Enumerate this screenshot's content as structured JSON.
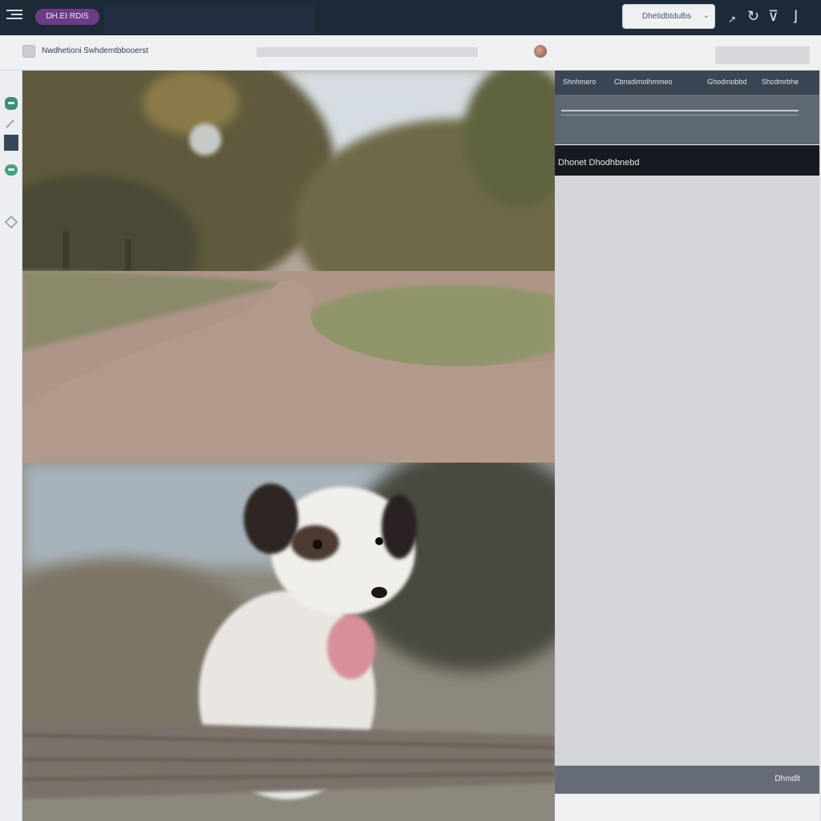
{
  "topbar": {
    "pill_label": "DH.EI RDIS",
    "button_label": "Dhetidbtdulbs",
    "icons": [
      "menu-icon",
      "chevron-down-icon",
      "arrow-icon",
      "refresh-icon",
      "pin-icon",
      "corner-icon"
    ]
  },
  "address": {
    "site_title": "Nwdhetioni Swhdemtbbooerst"
  },
  "tabs": [
    "Shnhmero",
    "Cbnsdimolhmmeo",
    "Ghodmobbd",
    "Shcdmrbhe"
  ],
  "panel": {
    "header_title": "Dhonet Dhodhbnebd",
    "footer_label": "Dhmdlt"
  },
  "photos": [
    {
      "subject": "tree-lined-road"
    },
    {
      "subject": "white-puppy"
    }
  ],
  "colors": {
    "topbar": "#1f2a38",
    "accent": "#6b3d86",
    "panel_header": "#161a20"
  }
}
